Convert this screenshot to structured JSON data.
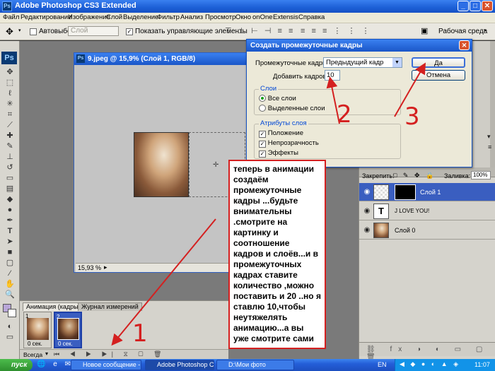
{
  "titlebar": {
    "title": "Adobe Photoshop CS3 Extended"
  },
  "menu": [
    "Файл",
    "Редактирование",
    "Изображение",
    "Слой",
    "Выделение",
    "Фильтр",
    "Анализ",
    "Просмотр",
    "Окно",
    "onOne",
    "Extensis",
    "Справка"
  ],
  "options": {
    "autoselect_label": "Автовыбор:",
    "autoselect_value": "Слой",
    "show_controls_label": "Показать управляющие элементы",
    "workspace_label": "Рабочая среда"
  },
  "document": {
    "title": "9.jpeg @ 15,9% (Слой 1, RGB/8)",
    "zoom": "15,93 %"
  },
  "dialog": {
    "title": "Создать промежуточные кадры",
    "tween_with_label": "Промежуточные кадры:",
    "tween_with_value": "Предыдущий кадр",
    "frames_to_add_label": "Добавить кадров:",
    "frames_to_add_value": "10",
    "ok": "Да",
    "cancel": "Отмена",
    "layers_group": "Слои",
    "all_layers": "Все слои",
    "selected_layers": "Выделенные слои",
    "params_group": "Атрибуты слоя",
    "position": "Положение",
    "opacity": "Непрозрачность",
    "effects": "Эффекты"
  },
  "layers_panel": {
    "lock_label": "Закрепить:",
    "fill_label": "Заливка:",
    "fill_value": "100%",
    "layers": [
      {
        "name": "Слой 1",
        "selected": true
      },
      {
        "name": "J LOVE YOU!",
        "selected": false
      },
      {
        "name": "Слой 0",
        "selected": false
      }
    ]
  },
  "annotations": {
    "note": "теперь в анимации создаём промежуточные кадры ...будьте внимательны .смотрите на картинку и соотношение кадров и слоёв...и в промежуточных кадрах ставите количество ,можно поставить и 20 ..но я ставлю 10,чтобы неутяжелять анимацию...а вы уже смотрите сами",
    "n1": "1",
    "n2": "2",
    "n3": "3"
  },
  "animation": {
    "tab_animation": "Анимация (кадры)",
    "tab_history": "Журнал измерений",
    "frames": [
      {
        "number": "1",
        "delay": "0 сек."
      },
      {
        "number": "2",
        "delay": "0 сек."
      }
    ],
    "loop": "Всегда"
  },
  "taskbar": {
    "start": "пуск",
    "tasks": [
      "Новое сообщение - ...",
      "Adobe Photoshop CS...",
      "D:\\Мои фото"
    ],
    "lang": "EN",
    "clock": "11:07"
  },
  "colors": {
    "accent": "#d42020",
    "selection": "#3a5ec0"
  }
}
